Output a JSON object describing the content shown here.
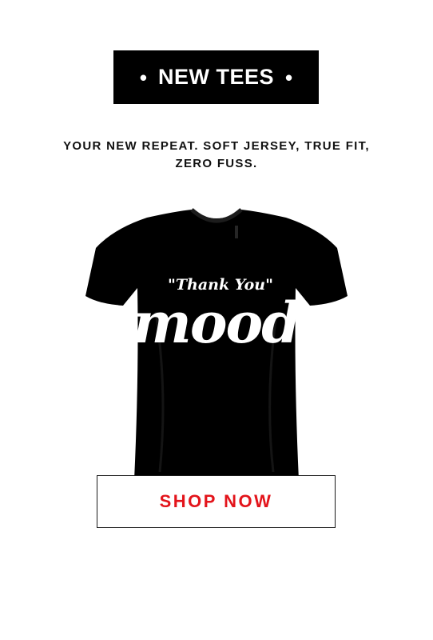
{
  "banner": {
    "dot_left": "•",
    "title": "NEW TEES",
    "dot_right": "•"
  },
  "subtitle": {
    "line1": "YOUR NEW REPEAT. SOFT JERSEY, TRUE FIT,",
    "line2": "ZERO FUSS."
  },
  "product": {
    "print_top": "\"Thank You\"",
    "print_main": "mood",
    "shirt_color": "#000000",
    "print_color": "#ffffff"
  },
  "cta": {
    "label": "SHOP NOW",
    "color": "#e3141b"
  }
}
